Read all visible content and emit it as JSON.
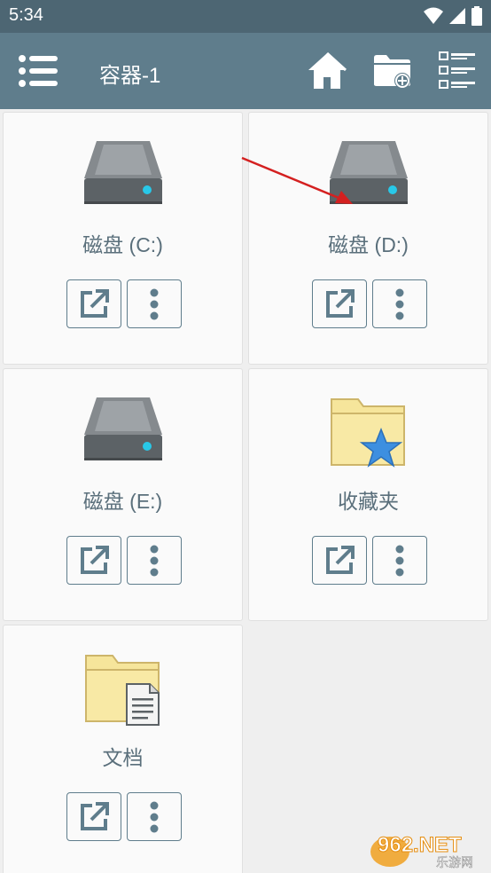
{
  "status_bar": {
    "time": "5:34",
    "icons": [
      "wifi-icon",
      "signal-icon",
      "battery-icon"
    ]
  },
  "app_bar": {
    "title": "容器-1",
    "icons": [
      "menu-icon",
      "home-icon",
      "new-folder-icon",
      "view-list-icon"
    ]
  },
  "items": [
    {
      "label": "磁盘 (C:)",
      "icon": "drive-icon"
    },
    {
      "label": "磁盘 (D:)",
      "icon": "drive-icon"
    },
    {
      "label": "磁盘 (E:)",
      "icon": "drive-icon"
    },
    {
      "label": "收藏夹",
      "icon": "favorites-folder-icon"
    },
    {
      "label": "文档",
      "icon": "documents-folder-icon"
    }
  ],
  "watermark": {
    "main": "962.NET",
    "sub": "乐游网"
  },
  "colors": {
    "status_bar": "#4d6673",
    "app_bar": "#5f7d8c",
    "label": "#5a6f7b",
    "folder": "#f6e59b",
    "star": "#3d8fe0",
    "drive_led": "#28c8e8"
  }
}
